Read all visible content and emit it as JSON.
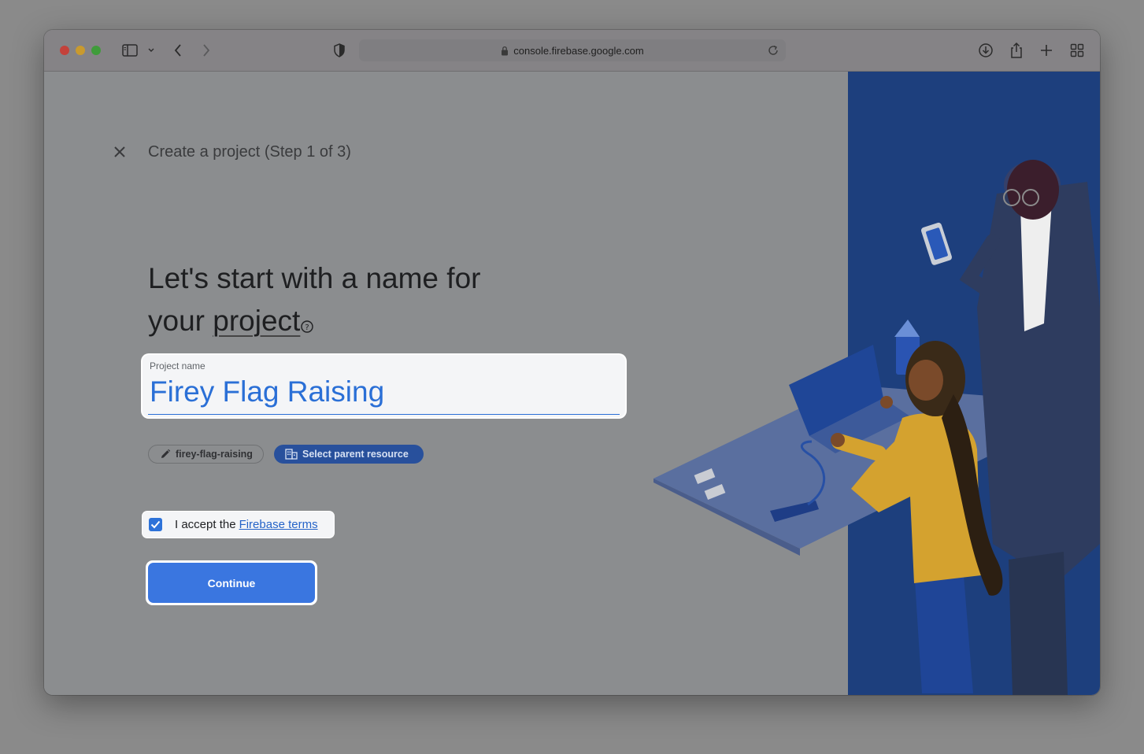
{
  "browser": {
    "url": "console.firebase.google.com",
    "icons": [
      "sidebar-icon",
      "chevron-down-icon",
      "back-icon",
      "forward-icon",
      "privacy-shield-icon",
      "lock-icon",
      "reload-icon",
      "download-icon",
      "share-icon",
      "new-tab-icon",
      "tab-overview-icon"
    ]
  },
  "page": {
    "step_title": "Create a project (Step 1 of 3)",
    "headline_line1": "Let's start with a name for",
    "headline_line2_prefix": "your ",
    "headline_line2_link": "project",
    "project_field": {
      "label": "Project name",
      "value": "Firey Flag Raising"
    },
    "chips": {
      "project_id": "firey-flag-raising",
      "parent_resource": "Select parent resource"
    },
    "terms": {
      "checked": true,
      "prefix": "I accept the",
      "link": "Firebase terms"
    },
    "continue_label": "Continue"
  },
  "colors": {
    "accent": "#3a76e0",
    "illustration_panel": "#1d3f7d",
    "chip_parent": "#28509c"
  }
}
